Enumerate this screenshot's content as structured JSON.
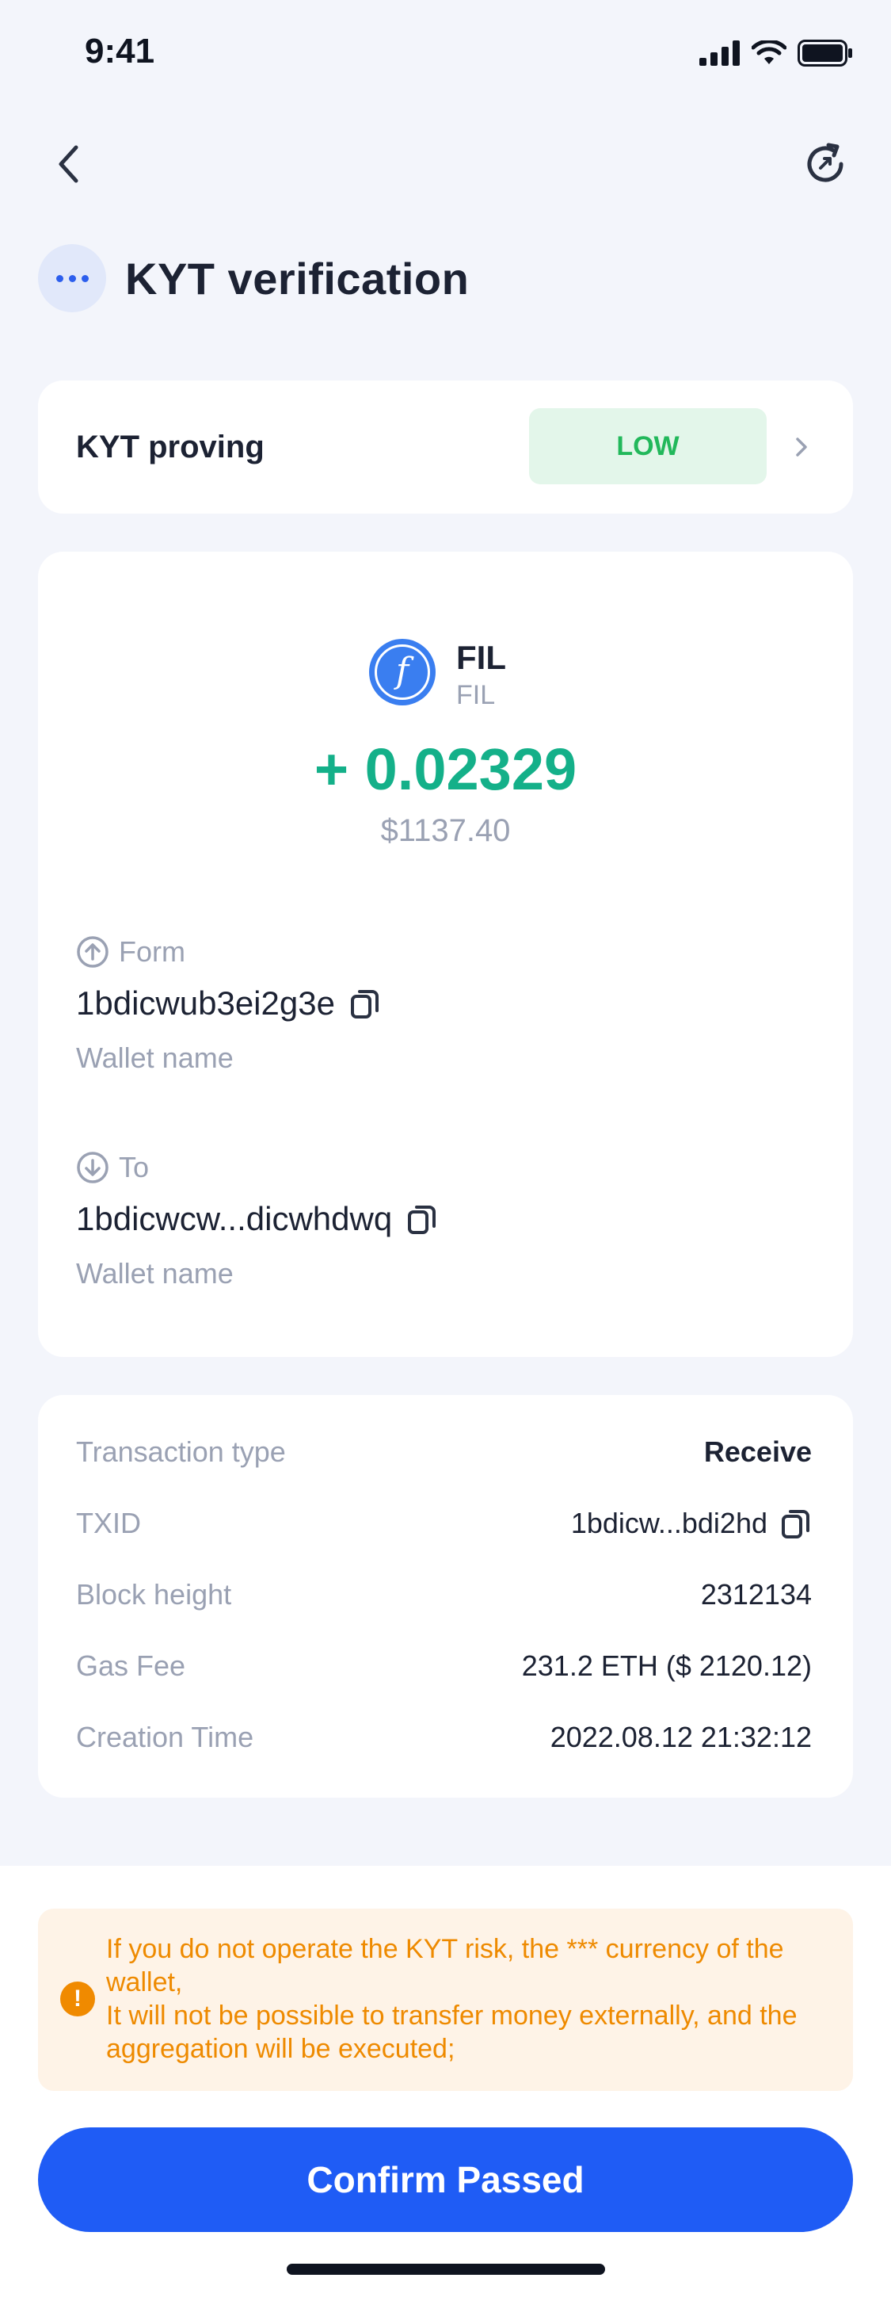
{
  "status_bar": {
    "time": "9:41"
  },
  "icons": {
    "back": "chevron-left-icon",
    "refresh": "refresh-icon",
    "more": "more-dots-icon",
    "chevron": "chevron-right-icon",
    "copy": "copy-icon",
    "arrow_up": "arrow-up-circle-icon",
    "arrow_down": "arrow-down-circle-icon",
    "warning": "warning-icon",
    "coin": "filecoin-icon"
  },
  "header": {
    "title": "KYT verification"
  },
  "kyt": {
    "label": "KYT proving",
    "risk_level": "LOW"
  },
  "transaction": {
    "coin_name": "FIL",
    "coin_symbol": "FIL",
    "amount": "+ 0.02329",
    "fiat_value": "$1137.40",
    "from": {
      "label": "Form",
      "address": "1bdicwub3ei2g3e",
      "wallet": "Wallet name"
    },
    "to": {
      "label": "To",
      "address": "1bdicwcw...dicwhdwq",
      "wallet": "Wallet name"
    }
  },
  "details": [
    {
      "label": "Transaction type",
      "value": "Receive"
    },
    {
      "label": "TXID",
      "value": "1bdicw...bdi2hd"
    },
    {
      "label": "Block height",
      "value": "2312134"
    },
    {
      "label": "Gas Fee",
      "value": "231.2 ETH ($ 2120.12)"
    },
    {
      "label": "Creation Time",
      "value": "2022.08.12 21:32:12"
    }
  ],
  "warning": {
    "line1": "If you do not operate the KYT risk, the *** currency of the wallet,",
    "line2": "It will not be possible to transfer money externally, and the aggregation will be executed;"
  },
  "actions": {
    "confirm_label": "Confirm Passed"
  },
  "colors": {
    "accent": "#1f5cf5",
    "positive": "#14b089",
    "risk_low": "#22b85b",
    "warning": "#ee8a00"
  }
}
